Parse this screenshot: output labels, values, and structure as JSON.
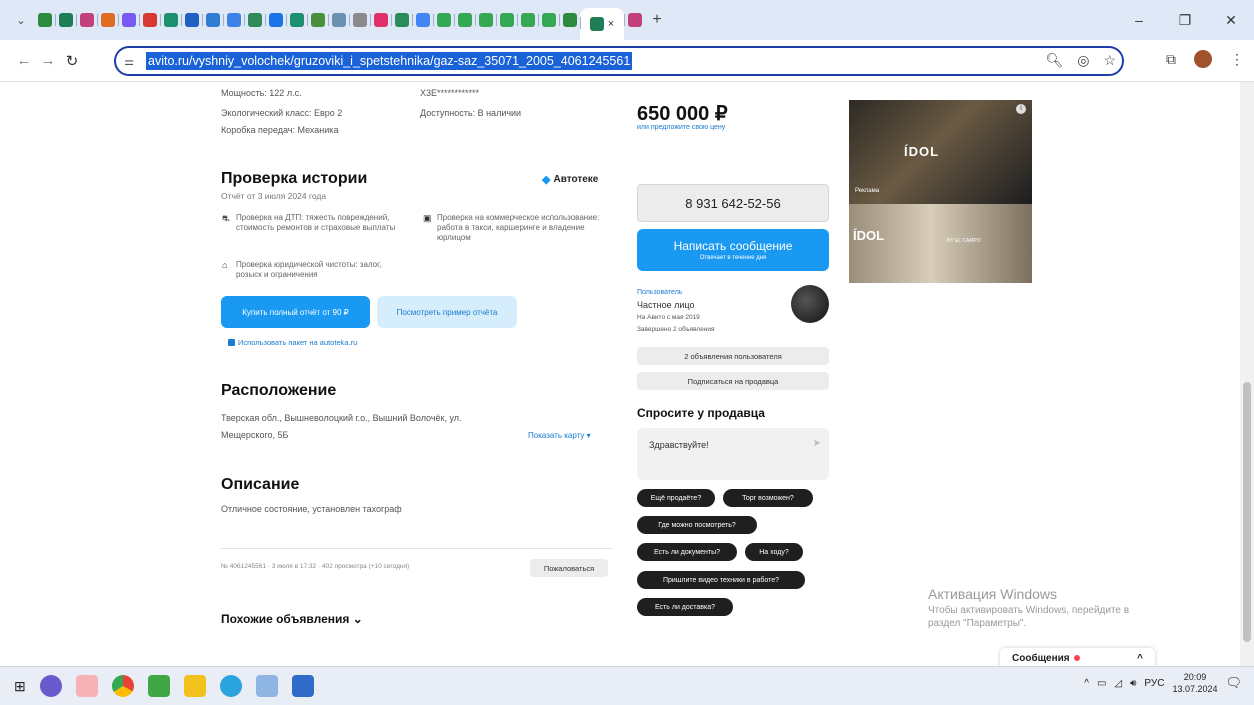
{
  "browser": {
    "tab_count_icons": 28,
    "active_tab_close": "×",
    "new_tab": "+",
    "window_controls": [
      "–",
      "❐",
      "✕"
    ],
    "url": "avito.ru/vyshniy_volochek/gruzoviki_i_spetstehnika/gaz-saz_35071_2005_4061245561"
  },
  "specs": {
    "power": "Мощность: 122 л.с.",
    "eco_class": "Экологический класс: Евро 2",
    "gearbox": "Коробка передач: Механика",
    "vin_label": "",
    "vin": "X3E************",
    "availability": "Доступность: В наличии"
  },
  "history": {
    "title": "Проверка истории",
    "provider": "Автотеке",
    "report_date": "Отчёт от 3 июля 2024 года",
    "features": [
      {
        "text": "Проверка на ДТП: тяжесть повреждений, стоимость ремонтов и страховые выплаты"
      },
      {
        "text": "Проверка на коммерческое использование: работа в такси, каршеринге и владение юрлицом"
      },
      {
        "text": "Проверка юридической чистоты: залог, розыск и ограничения"
      }
    ],
    "buy_button": "Купить полный отчёт от 90 ₽",
    "sample_button": "Посмотреть пример отчёта",
    "package_link": "Использовать пакет на autoteka.ru"
  },
  "location": {
    "title": "Расположение",
    "address_line1": "Тверская обл., Вышневолоцкий г.о., Вышний Волочёк, ул.",
    "address_line2": "Мещерского, 5Б",
    "show_map": "Показать карту ▾"
  },
  "description": {
    "title": "Описание",
    "text": "Отличное состояние, установлен тахограф"
  },
  "meta": {
    "info": "№ 4061245561 · 3 июля в 17:32 · 402 просмотра (+10 сегодня)",
    "complain": "Пожаловаться"
  },
  "similar": {
    "title": "Похожие объявления ⌄"
  },
  "price": {
    "value": "650 000 ₽",
    "offer_link": "или предложите свою цену"
  },
  "seller": {
    "phone": "8 931 642-52-56",
    "write_button": "Написать сообщение",
    "write_sub": "Отвечает в течение дня",
    "role": "Пользователь",
    "type": "Частное лицо",
    "since": "На Авито с мая 2019",
    "completed": "Завершено 2 объявления",
    "ads_button": "2 объявления пользователя",
    "subscribe_button": "Подписаться на продавца"
  },
  "ask": {
    "title": "Спросите у продавца",
    "message": "Здравствуйте!",
    "send": "➤",
    "chips": [
      "Ещё продаёте?",
      "Торг возможен?",
      "Где можно посмотреть?",
      "Есть ли документы?",
      "На ходу?",
      "Пришлите видео техники в работе?",
      "Есть ли доставка?"
    ]
  },
  "ad": {
    "brand": "ÍDOL",
    "label": "Реклама",
    "sub": "BY EL CAMPO"
  },
  "windows": {
    "activation_title": "Активация Windows",
    "activation_text1": "Чтобы активировать Windows, перейдите в",
    "activation_text2": "раздел \"Параметры\".",
    "messages": "Сообщения",
    "lang": "РУС",
    "time": "20:09",
    "date": "13.07.2024"
  },
  "colors": {
    "accent": "#1a99f2",
    "url_highlight": "#1a62d8",
    "chip_bg": "#1f1f1f"
  }
}
